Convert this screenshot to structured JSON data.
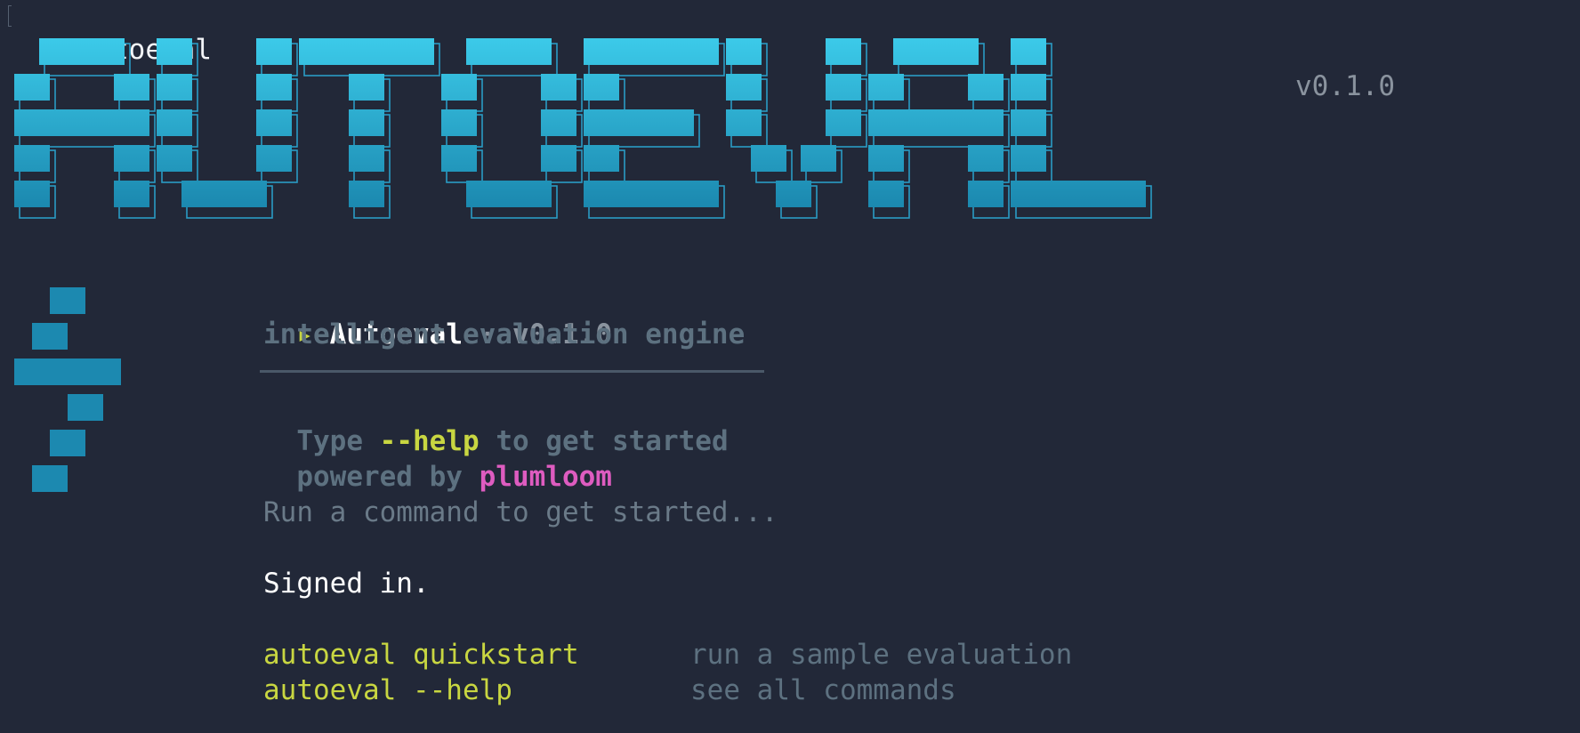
{
  "terminal": {
    "prompt_symbol": "%",
    "command": "autoeval"
  },
  "banner": {
    "word": "AUTOEVAL",
    "version": "v0.1.0"
  },
  "info": {
    "arrow_glyph": "▸",
    "app_name": "Autoeval",
    "separator": "·",
    "version": "v0.1.0",
    "tagline": "intelligent evaluation engine",
    "help_prefix": "Type",
    "help_flag": "--help",
    "help_suffix": "to get started",
    "powered_prefix": "powered by",
    "powered_brand": "plumloom"
  },
  "status": {
    "run_hint": "Run a command to get started...",
    "signed_in": "Signed in."
  },
  "commands": [
    {
      "command": "autoeval quickstart",
      "description": "run a sample evaluation"
    },
    {
      "command": "autoeval --help",
      "description": "see all commands"
    }
  ],
  "colors": {
    "background": "#222838",
    "banner_cyan_light": "#3cc8e8",
    "banner_cyan_dark": "#1a86ad",
    "accent_yellow": "#c8d641",
    "accent_magenta": "#de5cc0",
    "muted": "#5d7180",
    "text": "#ffffff"
  }
}
